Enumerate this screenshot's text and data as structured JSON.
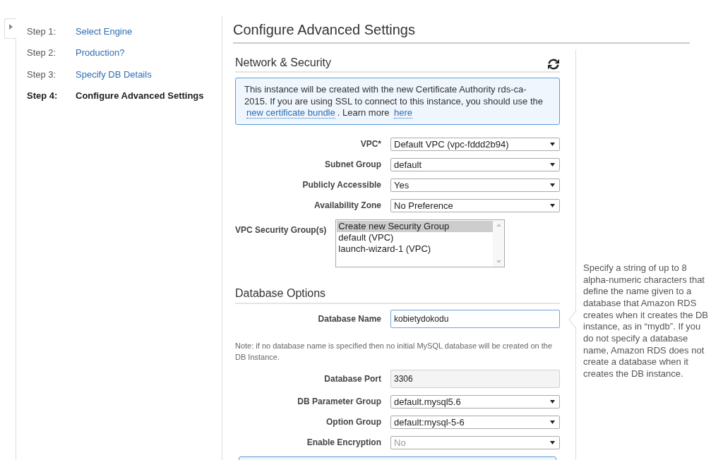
{
  "sidebar": {
    "steps": [
      {
        "label": "Step 1:",
        "title": "Select Engine",
        "selected": false
      },
      {
        "label": "Step 2:",
        "title": "Production?",
        "selected": false
      },
      {
        "label": "Step 3:",
        "title": "Specify DB Details",
        "selected": false
      },
      {
        "label": "Step 4:",
        "title": "Configure Advanced Settings",
        "selected": true
      }
    ]
  },
  "page_title": "Configure Advanced Settings",
  "network_security": {
    "title": "Network & Security",
    "notice": [
      {
        "kind": "text",
        "text": "This instance will be created with the new Certificate Authority rds-ca-2015. If you are using SSL to connect to this instance, you should use the "
      },
      {
        "kind": "link",
        "text": "new certificate bundle"
      },
      {
        "kind": "text",
        "text": ". Learn more "
      },
      {
        "kind": "link",
        "text": "here"
      }
    ],
    "fields": [
      {
        "kind": "select",
        "label": "VPC*",
        "value": "Default VPC (vpc-fddd2b94)",
        "disabled": false
      },
      {
        "kind": "select",
        "label": "Subnet Group",
        "value": "default",
        "disabled": false
      },
      {
        "kind": "select",
        "label": "Publicly Accessible",
        "value": "Yes",
        "disabled": false
      },
      {
        "kind": "select",
        "label": "Availability Zone",
        "value": "No Preference",
        "disabled": false
      },
      {
        "kind": "multiselect",
        "label": "VPC Security Group(s)",
        "options": [
          {
            "text": "Create new Security Group",
            "selected": true
          },
          {
            "text": "default (VPC)",
            "selected": false
          },
          {
            "text": "launch-wizard-1 (VPC)",
            "selected": false
          }
        ]
      }
    ]
  },
  "database_options": {
    "title": "Database Options",
    "fields": [
      {
        "kind": "text",
        "label": "Database Name",
        "value": "kobietydokodu",
        "focused": true
      },
      {
        "kind": "note",
        "text": "Note: if no database name is specified then no initial MySQL database will be created on the DB Instance."
      },
      {
        "kind": "text",
        "label": "Database Port",
        "value": "3306",
        "focused": false
      },
      {
        "kind": "select",
        "label": "DB Parameter Group",
        "value": "default.mysql5.6",
        "disabled": false
      },
      {
        "kind": "select",
        "label": "Option Group",
        "value": "default:mysql-5-6",
        "disabled": false
      },
      {
        "kind": "select",
        "label": "Enable Encryption",
        "value": "No",
        "disabled": true
      }
    ]
  },
  "help": {
    "text": "Specify a string of up to 8 alpha-numeric characters that define the name given to a database that Amazon RDS creates when it creates the DB instance, as in “mydb”. If you do not specify a database name, Amazon RDS does not create a database when it creates the DB instance."
  }
}
